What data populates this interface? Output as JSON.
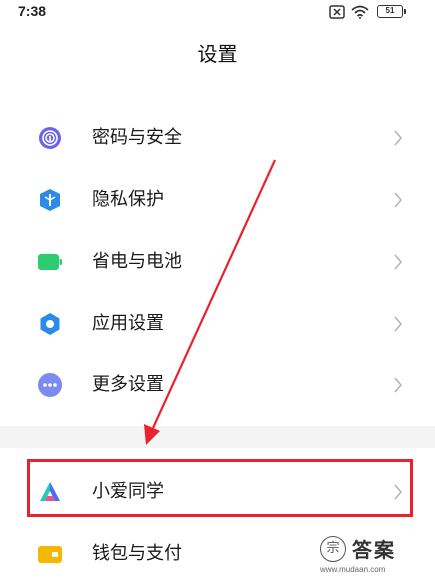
{
  "status_bar": {
    "time": "7:38",
    "battery_level": "51",
    "icons": [
      "no-sim-icon",
      "wifi-icon",
      "battery-icon"
    ]
  },
  "header": {
    "title": "设置"
  },
  "settings": {
    "items": [
      {
        "label": "密码与安全",
        "icon": "fingerprint-icon",
        "icon_color": "#6b63e8"
      },
      {
        "label": "隐私保护",
        "icon": "privacy-shield-icon",
        "icon_color": "#2b8be8"
      },
      {
        "label": "省电与电池",
        "icon": "battery-saver-icon",
        "icon_color": "#2ecc71"
      },
      {
        "label": "应用设置",
        "icon": "app-gear-icon",
        "icon_color": "#2b8be8"
      },
      {
        "label": "更多设置",
        "icon": "more-dots-icon",
        "icon_color": "#7b8bf0"
      },
      {
        "label": "小爱同学",
        "icon": "xiaoai-icon",
        "icon_color": "#4a6cf7",
        "highlighted": true
      },
      {
        "label": "钱包与支付",
        "icon": "wallet-icon",
        "icon_color": "#f5b800"
      }
    ]
  },
  "annotation": {
    "highlight_color": "#e8232d"
  },
  "watermark": {
    "logo_char": "宗",
    "text": "答案",
    "url": "www.mudaan.com"
  }
}
